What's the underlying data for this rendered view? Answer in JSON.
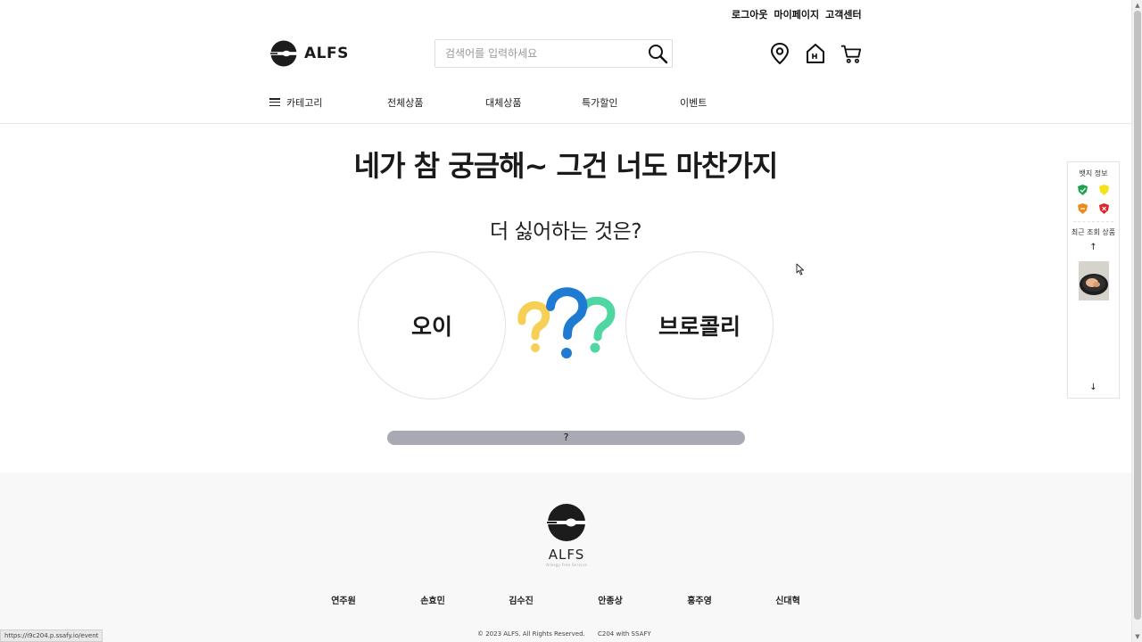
{
  "util_links": [
    "로그아웃",
    "마이페이지",
    "고객센터"
  ],
  "brand": {
    "name": "ALFS",
    "sub": "Allergy Free Service"
  },
  "search": {
    "placeholder": "검색어를 입력하세요",
    "value": ""
  },
  "header_icons": [
    "location-pin-icon",
    "home-icon",
    "cart-icon"
  ],
  "nav": {
    "category_label": "카테고리",
    "items": [
      "전체상품",
      "대체상품",
      "특가할인",
      "이벤트"
    ]
  },
  "event": {
    "title": "네가 참 궁금해~ 그건 너도 마찬가지",
    "question": "더 싫어하는 것은?",
    "option_left": "오이",
    "option_right": "브로콜리",
    "progress_label": "?"
  },
  "side_panel": {
    "badge_title": "뱃지 정보",
    "recent_title": "최근 조회 상품",
    "badge_colors": [
      "#1aa34a",
      "#f5e31a",
      "#ef8a1a",
      "#e0262c"
    ],
    "up_arrow": "↑",
    "down_arrow": "↓"
  },
  "footer": {
    "brand": "ALFS",
    "members": [
      "연주원",
      "손효민",
      "김수진",
      "안종상",
      "홍주영",
      "신대혁"
    ],
    "copyright": "© 2023 ALFS. All Rights Reserved.",
    "credit": "C204 with SSAFY"
  },
  "status_url": "https://i9c204.p.ssafy.io/event",
  "colors": {
    "accent_dark": "#1a1a1a",
    "progress_bar": "#a7aab2",
    "footer_bg": "#f8f8f8"
  }
}
